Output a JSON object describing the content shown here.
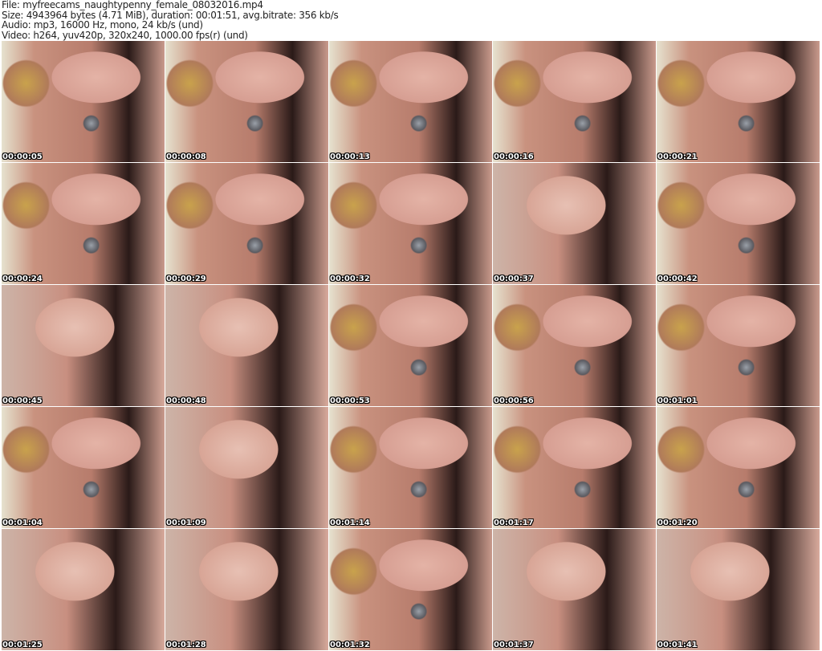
{
  "header": {
    "file": "File: myfreecams_naughtypenny_female_08032016.mp4",
    "size": "Size: 4943964 bytes (4.71 MiB), duration: 00:01:51, avg.bitrate: 356 kb/s",
    "audio": "Audio: mp3, 16000 Hz, mono, 24 kb/s (und)",
    "video": "Video: h264, yuv420p, 320x240, 1000.00 fps(r) (und)"
  },
  "thumbnails": [
    "00:00:05",
    "00:00:08",
    "00:00:13",
    "00:00:16",
    "00:00:21",
    "00:00:24",
    "00:00:29",
    "00:00:32",
    "00:00:37",
    "00:00:42",
    "00:00:45",
    "00:00:48",
    "00:00:53",
    "00:00:56",
    "00:01:01",
    "00:01:04",
    "00:01:09",
    "00:01:14",
    "00:01:17",
    "00:01:20",
    "00:01:25",
    "00:01:28",
    "00:01:32",
    "00:01:37",
    "00:01:41"
  ]
}
